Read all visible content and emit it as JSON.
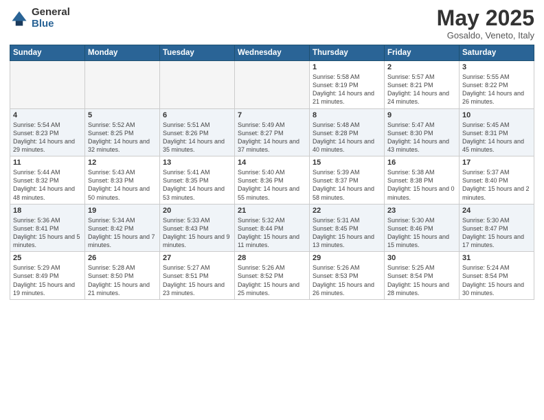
{
  "logo": {
    "general": "General",
    "blue": "Blue"
  },
  "title": "May 2025",
  "subtitle": "Gosaldo, Veneto, Italy",
  "weekdays": [
    "Sunday",
    "Monday",
    "Tuesday",
    "Wednesday",
    "Thursday",
    "Friday",
    "Saturday"
  ],
  "weeks": [
    [
      {
        "day": "",
        "info": ""
      },
      {
        "day": "",
        "info": ""
      },
      {
        "day": "",
        "info": ""
      },
      {
        "day": "",
        "info": ""
      },
      {
        "day": "1",
        "info": "Sunrise: 5:58 AM\nSunset: 8:19 PM\nDaylight: 14 hours\nand 21 minutes."
      },
      {
        "day": "2",
        "info": "Sunrise: 5:57 AM\nSunset: 8:21 PM\nDaylight: 14 hours\nand 24 minutes."
      },
      {
        "day": "3",
        "info": "Sunrise: 5:55 AM\nSunset: 8:22 PM\nDaylight: 14 hours\nand 26 minutes."
      }
    ],
    [
      {
        "day": "4",
        "info": "Sunrise: 5:54 AM\nSunset: 8:23 PM\nDaylight: 14 hours\nand 29 minutes."
      },
      {
        "day": "5",
        "info": "Sunrise: 5:52 AM\nSunset: 8:25 PM\nDaylight: 14 hours\nand 32 minutes."
      },
      {
        "day": "6",
        "info": "Sunrise: 5:51 AM\nSunset: 8:26 PM\nDaylight: 14 hours\nand 35 minutes."
      },
      {
        "day": "7",
        "info": "Sunrise: 5:49 AM\nSunset: 8:27 PM\nDaylight: 14 hours\nand 37 minutes."
      },
      {
        "day": "8",
        "info": "Sunrise: 5:48 AM\nSunset: 8:28 PM\nDaylight: 14 hours\nand 40 minutes."
      },
      {
        "day": "9",
        "info": "Sunrise: 5:47 AM\nSunset: 8:30 PM\nDaylight: 14 hours\nand 43 minutes."
      },
      {
        "day": "10",
        "info": "Sunrise: 5:45 AM\nSunset: 8:31 PM\nDaylight: 14 hours\nand 45 minutes."
      }
    ],
    [
      {
        "day": "11",
        "info": "Sunrise: 5:44 AM\nSunset: 8:32 PM\nDaylight: 14 hours\nand 48 minutes."
      },
      {
        "day": "12",
        "info": "Sunrise: 5:43 AM\nSunset: 8:33 PM\nDaylight: 14 hours\nand 50 minutes."
      },
      {
        "day": "13",
        "info": "Sunrise: 5:41 AM\nSunset: 8:35 PM\nDaylight: 14 hours\nand 53 minutes."
      },
      {
        "day": "14",
        "info": "Sunrise: 5:40 AM\nSunset: 8:36 PM\nDaylight: 14 hours\nand 55 minutes."
      },
      {
        "day": "15",
        "info": "Sunrise: 5:39 AM\nSunset: 8:37 PM\nDaylight: 14 hours\nand 58 minutes."
      },
      {
        "day": "16",
        "info": "Sunrise: 5:38 AM\nSunset: 8:38 PM\nDaylight: 15 hours\nand 0 minutes."
      },
      {
        "day": "17",
        "info": "Sunrise: 5:37 AM\nSunset: 8:40 PM\nDaylight: 15 hours\nand 2 minutes."
      }
    ],
    [
      {
        "day": "18",
        "info": "Sunrise: 5:36 AM\nSunset: 8:41 PM\nDaylight: 15 hours\nand 5 minutes."
      },
      {
        "day": "19",
        "info": "Sunrise: 5:34 AM\nSunset: 8:42 PM\nDaylight: 15 hours\nand 7 minutes."
      },
      {
        "day": "20",
        "info": "Sunrise: 5:33 AM\nSunset: 8:43 PM\nDaylight: 15 hours\nand 9 minutes."
      },
      {
        "day": "21",
        "info": "Sunrise: 5:32 AM\nSunset: 8:44 PM\nDaylight: 15 hours\nand 11 minutes."
      },
      {
        "day": "22",
        "info": "Sunrise: 5:31 AM\nSunset: 8:45 PM\nDaylight: 15 hours\nand 13 minutes."
      },
      {
        "day": "23",
        "info": "Sunrise: 5:30 AM\nSunset: 8:46 PM\nDaylight: 15 hours\nand 15 minutes."
      },
      {
        "day": "24",
        "info": "Sunrise: 5:30 AM\nSunset: 8:47 PM\nDaylight: 15 hours\nand 17 minutes."
      }
    ],
    [
      {
        "day": "25",
        "info": "Sunrise: 5:29 AM\nSunset: 8:49 PM\nDaylight: 15 hours\nand 19 minutes."
      },
      {
        "day": "26",
        "info": "Sunrise: 5:28 AM\nSunset: 8:50 PM\nDaylight: 15 hours\nand 21 minutes."
      },
      {
        "day": "27",
        "info": "Sunrise: 5:27 AM\nSunset: 8:51 PM\nDaylight: 15 hours\nand 23 minutes."
      },
      {
        "day": "28",
        "info": "Sunrise: 5:26 AM\nSunset: 8:52 PM\nDaylight: 15 hours\nand 25 minutes."
      },
      {
        "day": "29",
        "info": "Sunrise: 5:26 AM\nSunset: 8:53 PM\nDaylight: 15 hours\nand 26 minutes."
      },
      {
        "day": "30",
        "info": "Sunrise: 5:25 AM\nSunset: 8:54 PM\nDaylight: 15 hours\nand 28 minutes."
      },
      {
        "day": "31",
        "info": "Sunrise: 5:24 AM\nSunset: 8:54 PM\nDaylight: 15 hours\nand 30 minutes."
      }
    ]
  ]
}
